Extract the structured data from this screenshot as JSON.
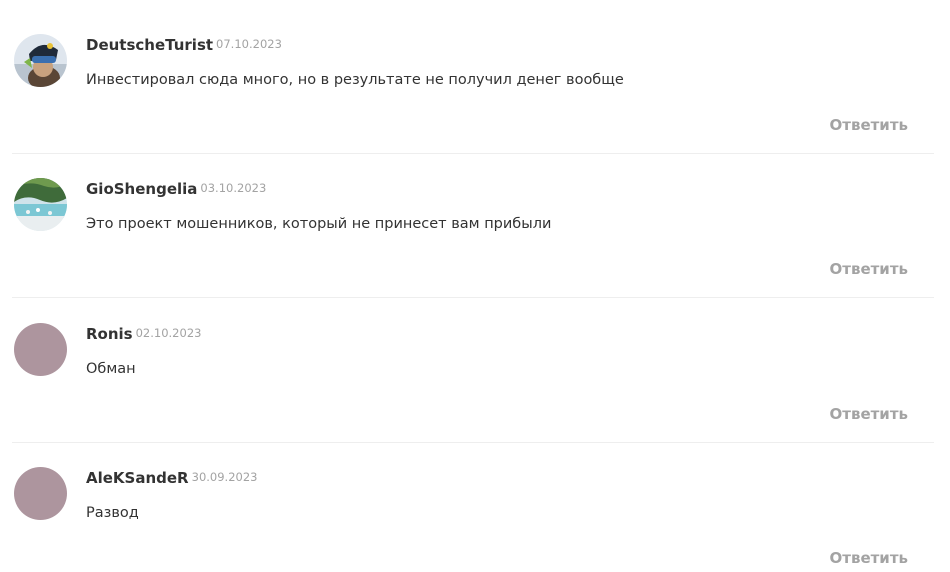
{
  "comments": [
    {
      "author": "DeutscheTurist",
      "date": "07.10.2023",
      "text": "Инвестировал сюда много, но в результате не получил денег вообще",
      "reply_label": "Ответить",
      "avatar": "photo-skier"
    },
    {
      "author": "GioShengelia",
      "date": "03.10.2023",
      "text": "Это проект мошенников, который не принесет вам прибыли",
      "reply_label": "Ответить",
      "avatar": "photo-beach"
    },
    {
      "author": "Ronis",
      "date": "02.10.2023",
      "text": "Обман",
      "reply_label": "Ответить",
      "avatar": "placeholder",
      "avatar_color": "#ad959e"
    },
    {
      "author": "AleKSandeR",
      "date": "30.09.2023",
      "text": "Развод",
      "reply_label": "Ответить",
      "avatar": "placeholder",
      "avatar_color": "#ad959e"
    }
  ]
}
